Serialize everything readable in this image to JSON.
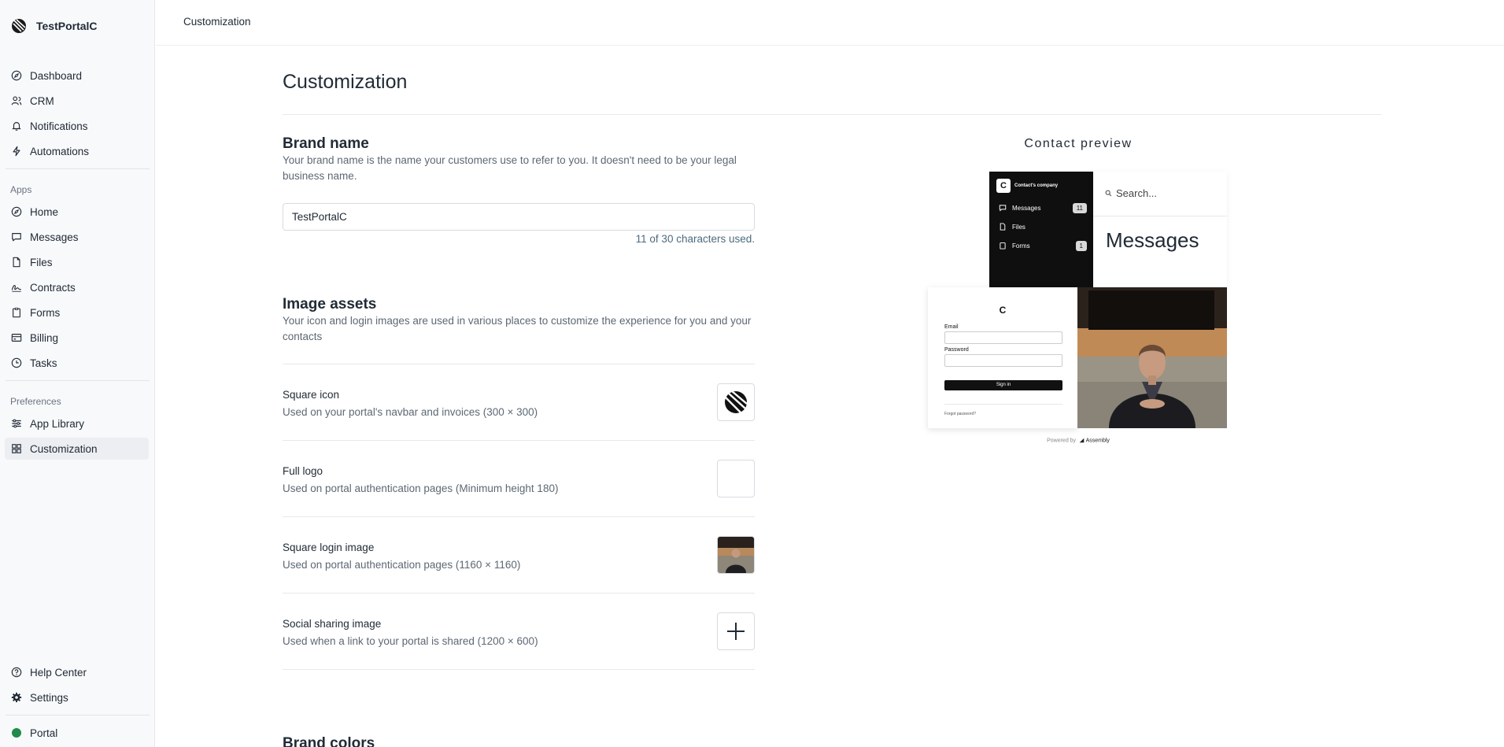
{
  "sidebar": {
    "brand_name": "TestPortalC",
    "main_items": [
      {
        "label": "Dashboard",
        "icon": "compass-icon"
      },
      {
        "label": "CRM",
        "icon": "users-icon"
      },
      {
        "label": "Notifications",
        "icon": "bell-icon"
      },
      {
        "label": "Automations",
        "icon": "lightning-icon"
      }
    ],
    "apps_label": "Apps",
    "app_items": [
      {
        "label": "Home",
        "icon": "home-icon"
      },
      {
        "label": "Messages",
        "icon": "message-icon"
      },
      {
        "label": "Files",
        "icon": "file-icon"
      },
      {
        "label": "Contracts",
        "icon": "signature-icon"
      },
      {
        "label": "Forms",
        "icon": "clipboard-icon"
      },
      {
        "label": "Billing",
        "icon": "billing-icon"
      },
      {
        "label": "Tasks",
        "icon": "tasks-icon"
      }
    ],
    "preferences_label": "Preferences",
    "preference_items": [
      {
        "label": "App Library",
        "icon": "sliders-icon"
      },
      {
        "label": "Customization",
        "icon": "grid-icon",
        "active": true
      }
    ],
    "help_label": "Help Center",
    "settings_label": "Settings",
    "portal_label": "Portal"
  },
  "topbar": {
    "breadcrumb": "Customization"
  },
  "main": {
    "title": "Customization",
    "brand_name_section": {
      "heading": "Brand name",
      "description": "Your brand name is the name your customers use to refer to you. It doesn't need to be your legal business name.",
      "input_value": "TestPortalC",
      "char_count": "11 of 30 characters used."
    },
    "image_assets": {
      "heading": "Image assets",
      "description": "Your icon and login images are used in various places to customize the experience for you and your contacts",
      "items": [
        {
          "title": "Square icon",
          "description": "Used on your portal's navbar and invoices (300 × 300)"
        },
        {
          "title": "Full logo",
          "description": "Used on portal authentication pages (Minimum height 180)"
        },
        {
          "title": "Square login image",
          "description": "Used on portal authentication pages (1160 × 1160)"
        },
        {
          "title": "Social sharing image",
          "description": "Used when a link to your portal is shared (1200 × 600)"
        }
      ]
    },
    "brand_colors_heading": "Brand colors"
  },
  "preview": {
    "label": "Contact preview",
    "company_initial": "C",
    "company_name": "Contact's company",
    "nav": [
      {
        "label": "Messages",
        "badge": "11"
      },
      {
        "label": "Files",
        "badge": ""
      },
      {
        "label": "Forms",
        "badge": "1"
      }
    ],
    "search_placeholder": "Search...",
    "content_title": "Messages",
    "login_initial": "C",
    "email_label": "Email",
    "password_label": "Password",
    "sign_in_label": "Sign in",
    "forgot_label": "Forgot password?",
    "powered_by": "Powered by",
    "powered_brand": "Assembly"
  }
}
